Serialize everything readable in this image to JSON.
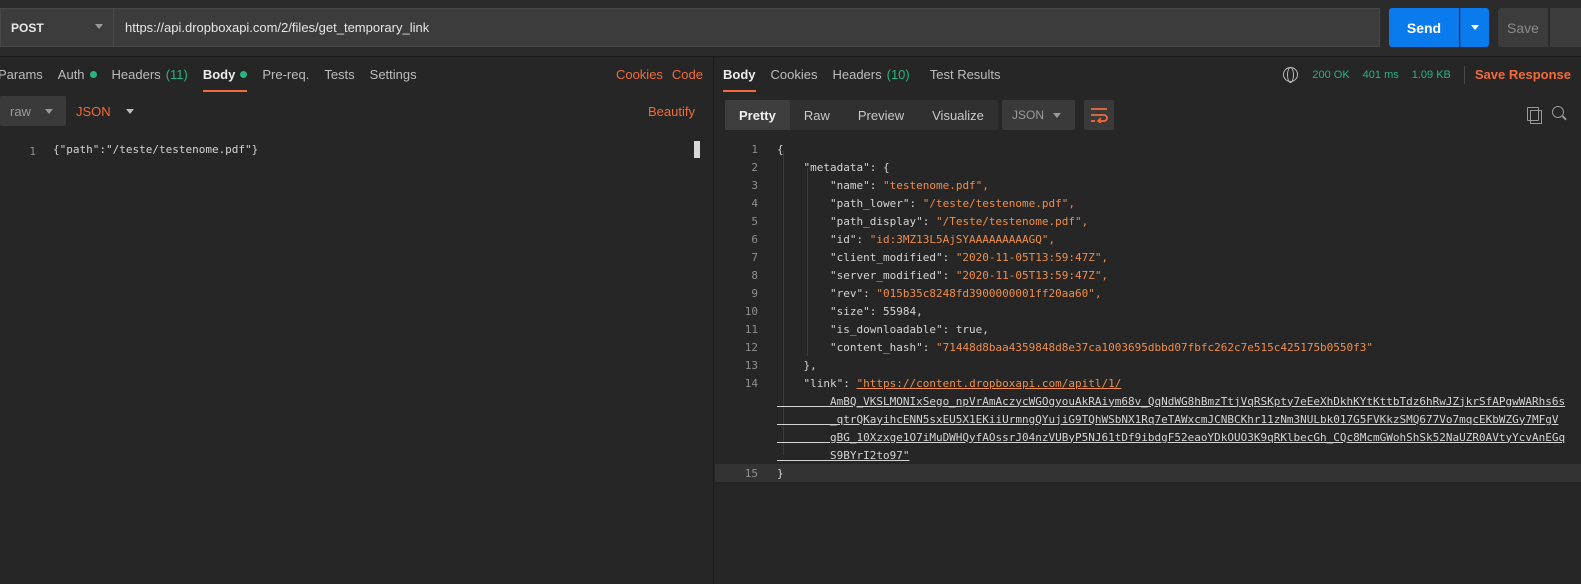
{
  "topbar": {
    "method": "POST",
    "url": "https://api.dropboxapi.com/2/files/get_temporary_link",
    "send_label": "Send",
    "save_label": "Save"
  },
  "request": {
    "tabs": [
      {
        "label": "Params"
      },
      {
        "label": "Auth"
      },
      {
        "label": "Headers",
        "count": "(11)"
      },
      {
        "label": "Body"
      },
      {
        "label": "Pre-req."
      },
      {
        "label": "Tests"
      },
      {
        "label": "Settings"
      }
    ],
    "cookies_label": "Cookies",
    "code_label": "Code",
    "body_mode": "raw",
    "body_language": "JSON",
    "beautify_label": "Beautify",
    "editor_line_number": "1",
    "editor_line": "{\"path\":\"/teste/testenome.pdf\"}"
  },
  "response": {
    "tabs": [
      {
        "label": "Body"
      },
      {
        "label": "Cookies"
      },
      {
        "label": "Headers",
        "count": "(10)"
      },
      {
        "label": "Test Results"
      }
    ],
    "status": "200 OK",
    "time": "401 ms",
    "size": "1.09 KB",
    "save_response_label": "Save Response",
    "view_modes": [
      "Pretty",
      "Raw",
      "Preview",
      "Visualize"
    ],
    "format": "JSON",
    "lines": [
      {
        "n": "1",
        "text": "{"
      },
      {
        "n": "2",
        "text": "    \"metadata\": {"
      },
      {
        "n": "3",
        "text": "        \"name\": \"testenome.pdf\","
      },
      {
        "n": "4",
        "text": "        \"path_lower\": \"/teste/testenome.pdf\","
      },
      {
        "n": "5",
        "text": "        \"path_display\": \"/Teste/testenome.pdf\","
      },
      {
        "n": "6",
        "text": "        \"id\": \"id:3MZ13L5AjSYAAAAAAAAAGQ\","
      },
      {
        "n": "7",
        "text": "        \"client_modified\": \"2020-11-05T13:59:47Z\","
      },
      {
        "n": "8",
        "text": "        \"server_modified\": \"2020-11-05T13:59:47Z\","
      },
      {
        "n": "9",
        "text": "        \"rev\": \"015b35c8248fd3900000001ff20aa60\","
      },
      {
        "n": "10",
        "text": "        \"size\": 55984,"
      },
      {
        "n": "11",
        "text": "        \"is_downloadable\": true,"
      },
      {
        "n": "12",
        "text": "        \"content_hash\": \"71448d8baa4359848d8e37ca1003695dbbd07fbfc262c7e515c425175b0550f3\""
      },
      {
        "n": "13",
        "text": "    },"
      },
      {
        "n": "14",
        "text": "    \"link\": \"https://content.dropboxapi.com/apitl/1/"
      },
      {
        "n": "",
        "text": "        AmBQ_VKSLMONIxSego_npVrAmAczycWGOgyouAkRAiym68v_QqNdWG8hBmzTtjVqRSKpty7eEeXhDkhKYtKttbTdz6hRwJZjkrSfAPgwWARhs6s"
      },
      {
        "n": "",
        "text": "        _qtrQKayihcENN5sxEU5X1EKiiUrmngQYujiG9TQhWSbNX1Rq7eTAWxcmJCNBCKhr11zNm3NULbk017G5FVKkzSMQ677Vo7mqcEKbWZGy7MFgV"
      },
      {
        "n": "",
        "text": "        gBG_10Xzxge1O7iMuDWHQyfAOssrJ04nzVUByP5NJ61tDf9ibdgF52eaoYDkOUO3K9qRKlbecGh_CQc8McmGWohShSk52NaUZR0AVtyYcvAnEGq"
      },
      {
        "n": "",
        "text": "        S9BYrI2to97\""
      },
      {
        "n": "15",
        "text": "}"
      }
    ]
  },
  "colors": {
    "accent": "#f26b3a",
    "send": "#097bed",
    "success": "#26b47f",
    "background": "#262626"
  }
}
